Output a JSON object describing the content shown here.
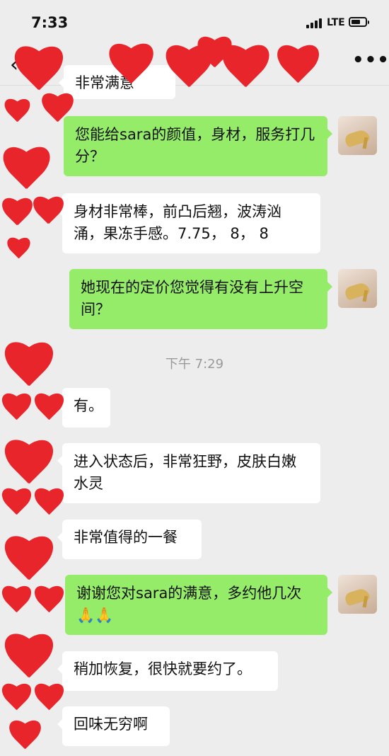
{
  "status_bar": {
    "time": "7:33",
    "network": "LTE"
  },
  "nav": {
    "back_icon": "chevron-left-icon",
    "more_icon": "more-dots-icon",
    "more_label": "•••"
  },
  "messages": [
    {
      "side": "in",
      "text": "非常满意"
    },
    {
      "side": "out",
      "text": "您能给sara的颜值，身材，服务打几分？"
    },
    {
      "side": "in",
      "text": "身材非常棒，前凸后翘，波涛汹涌，果冻手感。7.75， 8， 8"
    },
    {
      "side": "out",
      "text": "她现在的定价您觉得有没有上升空间？"
    },
    {
      "side": "in",
      "text": "有。"
    },
    {
      "side": "in",
      "text": "进入状态后，非常狂野，皮肤白嫩水灵"
    },
    {
      "side": "in",
      "text": "非常值得的一餐"
    },
    {
      "side": "out",
      "text": "谢谢您对sara的满意，多约他几次🙏🙏"
    },
    {
      "side": "in",
      "text": "稍加恢复，很快就要约了。"
    },
    {
      "side": "in",
      "text": "回味无穷啊"
    }
  ],
  "timestamp": "下午 7:29",
  "colors": {
    "background": "#ededed",
    "outgoing_bubble": "#95ec69",
    "incoming_bubble": "#ffffff",
    "heart": "#e8252b"
  }
}
